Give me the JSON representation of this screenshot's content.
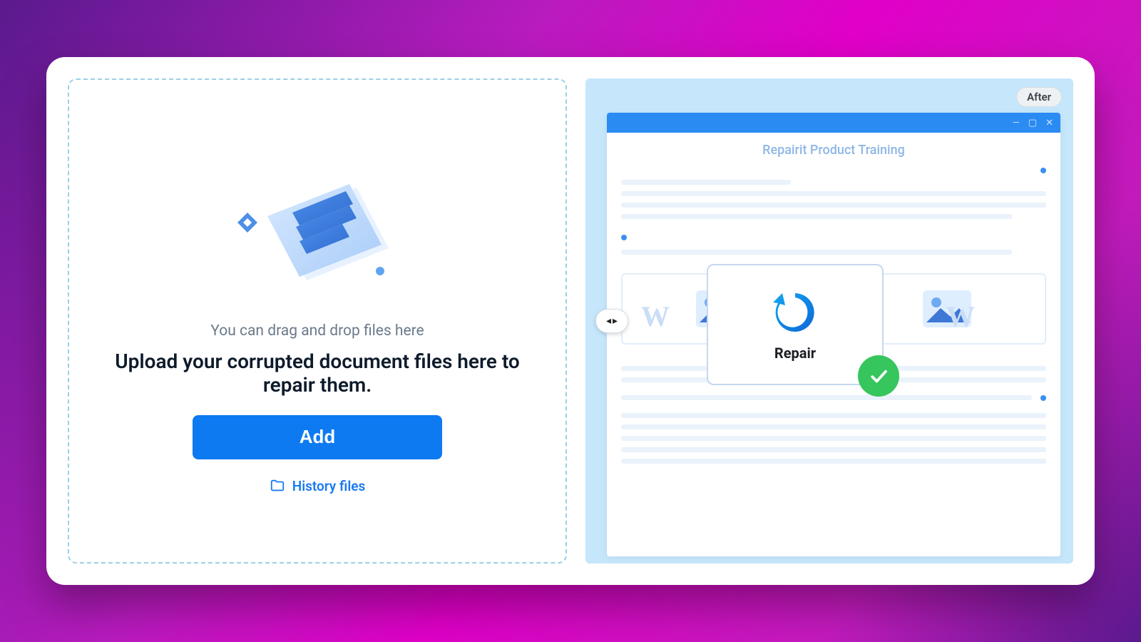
{
  "upload": {
    "hint": "You can drag and drop files here",
    "headline": "Upload your corrupted document files here to repair them.",
    "add_button": "Add",
    "history_link": "History files"
  },
  "preview": {
    "badge": "After",
    "window": {
      "doc_title": "Repairit Product Training",
      "minimize_glyph": "—",
      "maximize_glyph": "▢",
      "close_glyph": "✕"
    },
    "popup": {
      "label": "Repair"
    }
  },
  "colors": {
    "primary": "#0d7af2",
    "accent_green": "#37c55d"
  }
}
